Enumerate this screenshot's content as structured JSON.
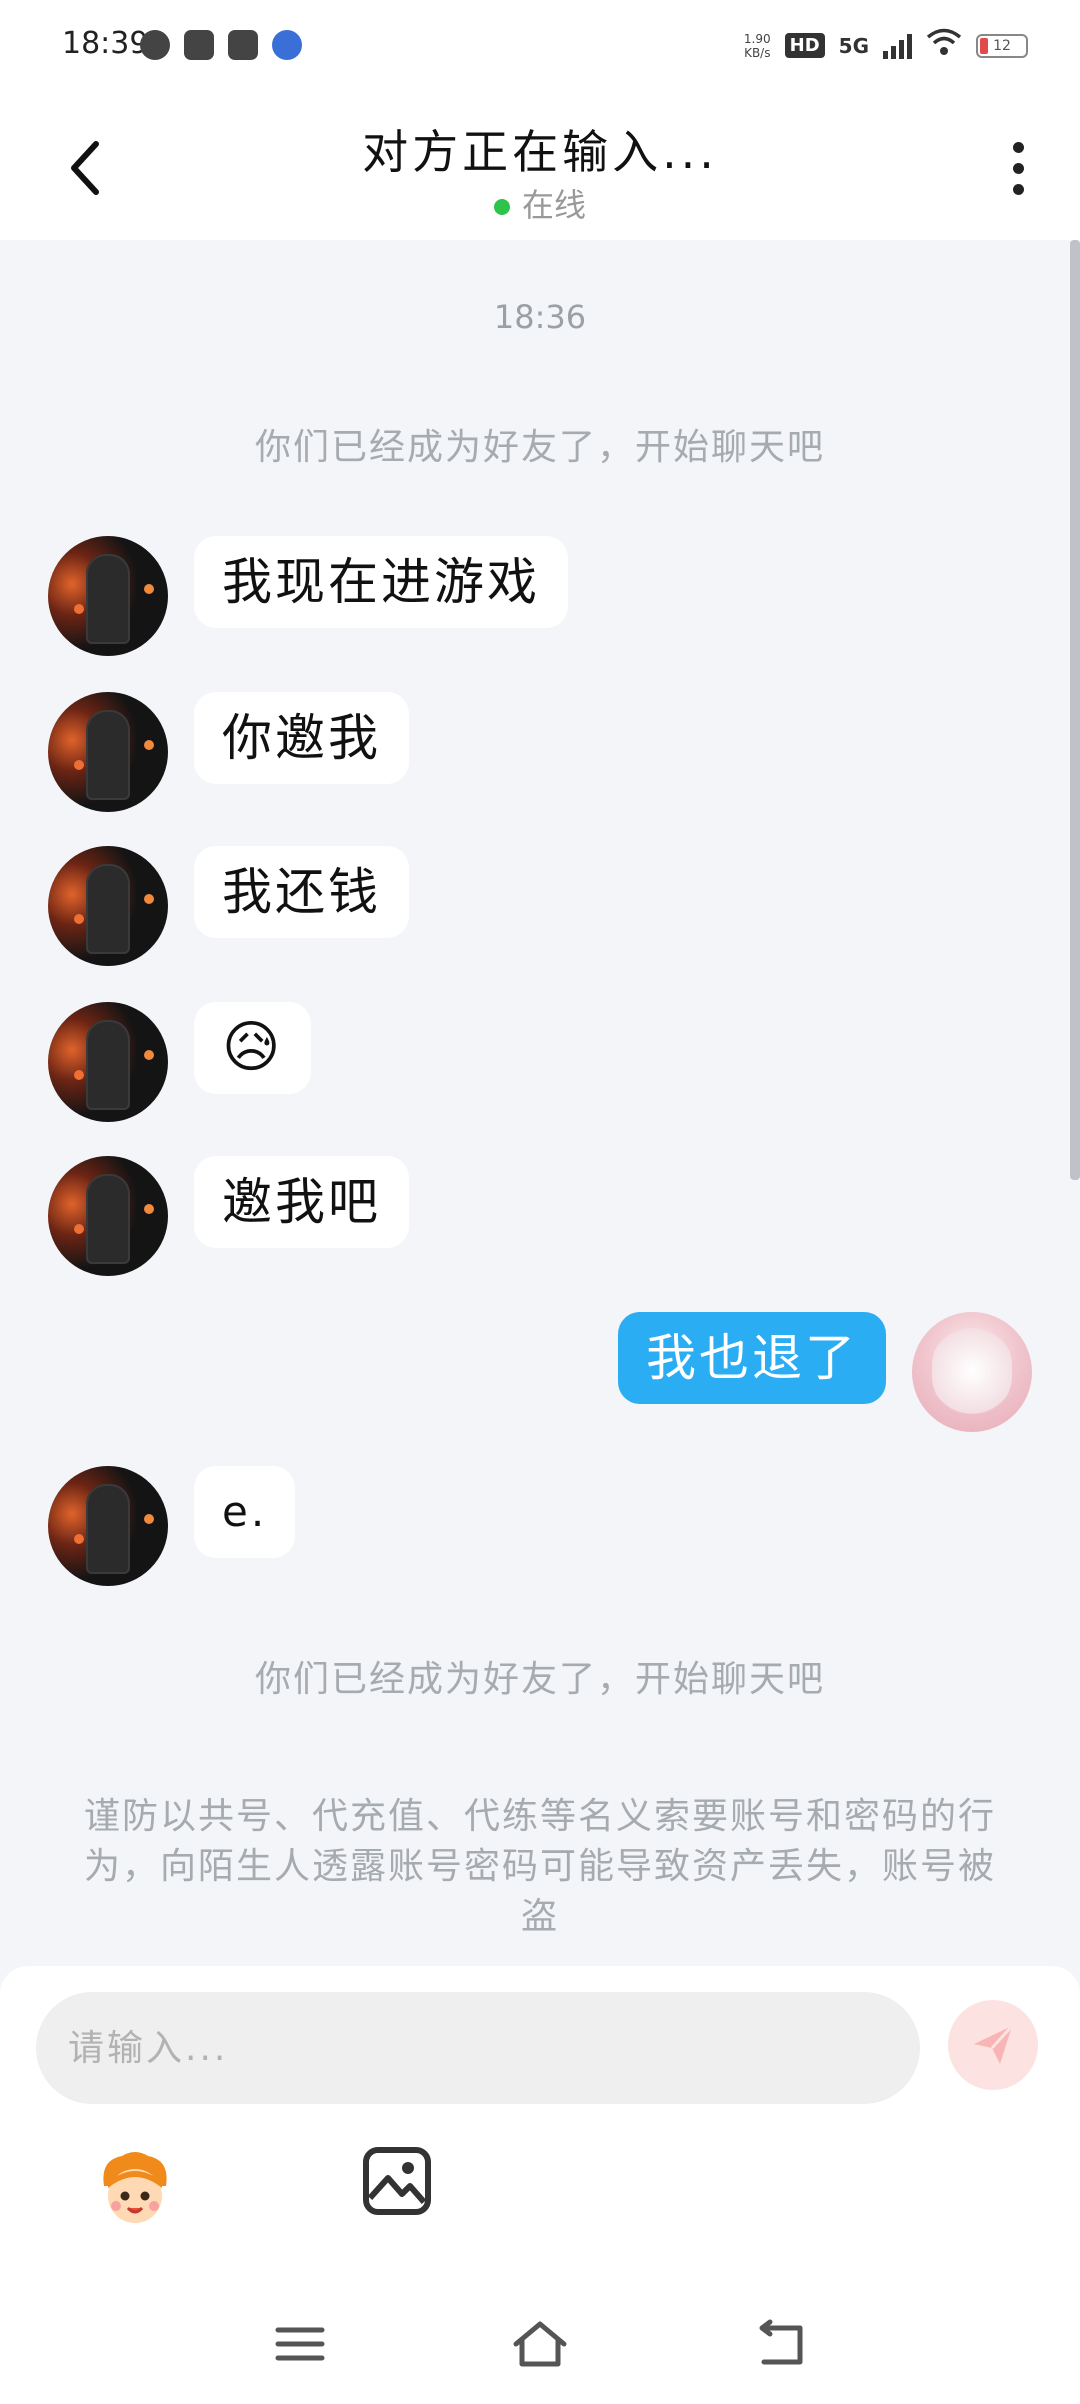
{
  "statusbar": {
    "time": "18:39",
    "net_speed_value": "1.90",
    "net_speed_unit": "KB/s",
    "hd_label": "HD",
    "network_type": "5G",
    "battery_level": "12"
  },
  "header": {
    "title": "对方正在输入...",
    "status": "在线"
  },
  "chat": {
    "timestamp": "18:36",
    "system_message_1": "你们已经成为好友了，开始聊天吧",
    "messages": [
      {
        "text": "我现在进游戏"
      },
      {
        "text": "你邀我"
      },
      {
        "text": "我还钱"
      },
      {
        "text": "😥"
      },
      {
        "text": "邀我吧"
      },
      {
        "text": "我也退了"
      },
      {
        "text": "e."
      }
    ],
    "system_message_2": "你们已经成为好友了，开始聊天吧",
    "safety_notice": "谨防以共号、代充值、代练等名义索要账号和密码的行为，向陌生人透露账号密码可能导致资产丢失，账号被盗"
  },
  "composer": {
    "placeholder": "请输入..."
  },
  "colors": {
    "accent_blue": "#2aadf3",
    "online_green": "#2ec34a",
    "send_disabled": "#fde2e2",
    "background": "#f3f5f8"
  },
  "icons": {
    "back": "back-arrow-icon",
    "menu": "more-vertical-icon",
    "send": "send-icon",
    "emoji": "emoji-sticker-icon",
    "image": "image-icon",
    "nav_menu": "nav-menu-icon",
    "nav_home": "nav-home-icon",
    "nav_back": "nav-back-icon"
  }
}
